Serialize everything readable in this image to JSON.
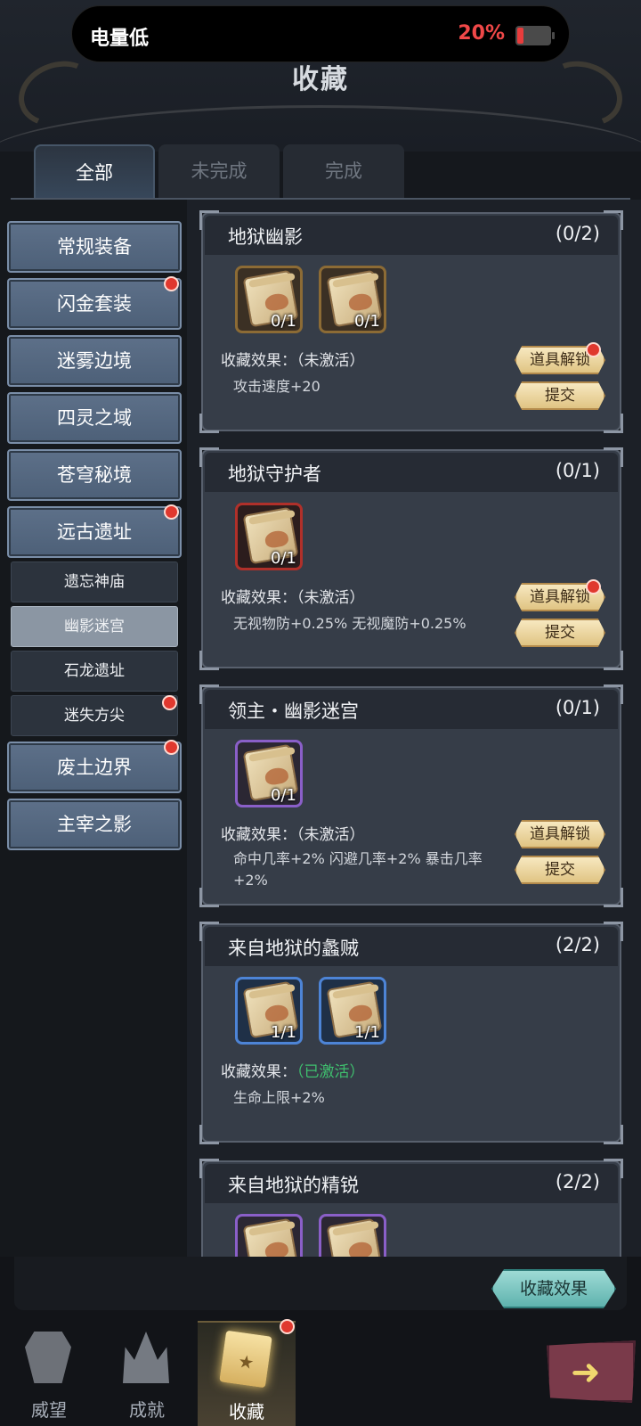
{
  "status": {
    "label": "电量低",
    "battery_pct": "20%",
    "battery_level": 0.2
  },
  "page": {
    "title": "收藏"
  },
  "tabs": [
    {
      "label": "全部",
      "active": true
    },
    {
      "label": "未完成",
      "active": false
    },
    {
      "label": "完成",
      "active": false
    }
  ],
  "sidebar": {
    "categories": [
      {
        "label": "常规装备",
        "dot": false
      },
      {
        "label": "闪金套装",
        "dot": true
      },
      {
        "label": "迷雾边境",
        "dot": false
      },
      {
        "label": "四灵之域",
        "dot": false
      },
      {
        "label": "苍穹秘境",
        "dot": false
      },
      {
        "label": "远古遗址",
        "dot": true
      }
    ],
    "subitems": [
      {
        "label": "遗忘神庙",
        "active": false,
        "dot": false
      },
      {
        "label": "幽影迷宫",
        "active": true,
        "dot": false
      },
      {
        "label": "石龙遗址",
        "active": false,
        "dot": false
      },
      {
        "label": "迷失方尖",
        "active": false,
        "dot": true
      }
    ],
    "categories_after": [
      {
        "label": "废土边界",
        "dot": true
      },
      {
        "label": "主宰之影",
        "dot": false
      }
    ]
  },
  "collections": [
    {
      "title": "地狱幽影",
      "count": "(0/2)",
      "items": [
        {
          "count": "0/1",
          "rarity": "gold"
        },
        {
          "count": "0/1",
          "rarity": "gold"
        }
      ],
      "effect_label": "收藏效果：",
      "effect_state": "（未激活）",
      "activated": false,
      "bonus": "攻击速度+20",
      "unlock_label": "道具解锁",
      "unlock_dot": true,
      "submit_label": "提交"
    },
    {
      "title": "地狱守护者",
      "count": "(0/1)",
      "items": [
        {
          "count": "0/1",
          "rarity": "red"
        }
      ],
      "effect_label": "收藏效果：",
      "effect_state": "（未激活）",
      "activated": false,
      "bonus": "无视物防+0.25% 无视魔防+0.25%",
      "unlock_label": "道具解锁",
      "unlock_dot": true,
      "submit_label": "提交"
    },
    {
      "title": "领主・幽影迷宫",
      "count": "(0/1)",
      "items": [
        {
          "count": "0/1",
          "rarity": "purple"
        }
      ],
      "effect_label": "收藏效果：",
      "effect_state": "（未激活）",
      "activated": false,
      "bonus": "命中几率+2% 闪避几率+2% 暴击几率+2%",
      "unlock_label": "道具解锁",
      "unlock_dot": false,
      "submit_label": "提交"
    },
    {
      "title": "来自地狱的蠡贼",
      "count": "(2/2)",
      "items": [
        {
          "count": "1/1",
          "rarity": "blue"
        },
        {
          "count": "1/1",
          "rarity": "blue"
        }
      ],
      "effect_label": "收藏效果：",
      "effect_state": "（已激活）",
      "activated": true,
      "bonus": "生命上限+2%"
    },
    {
      "title": "来自地狱的精锐",
      "count": "(2/2)",
      "items": [
        {
          "count": "",
          "rarity": "purple"
        },
        {
          "count": "",
          "rarity": "purple"
        }
      ]
    }
  ],
  "footer": {
    "effects_button": "收藏效果"
  },
  "nav": [
    {
      "label": "威望",
      "icon": "shield-icon",
      "active": false
    },
    {
      "label": "成就",
      "icon": "crown-icon",
      "active": false
    },
    {
      "label": "收藏",
      "icon": "collection-card-icon",
      "active": true,
      "dot": true
    }
  ],
  "exit": {
    "icon": "arrow-right-icon"
  }
}
